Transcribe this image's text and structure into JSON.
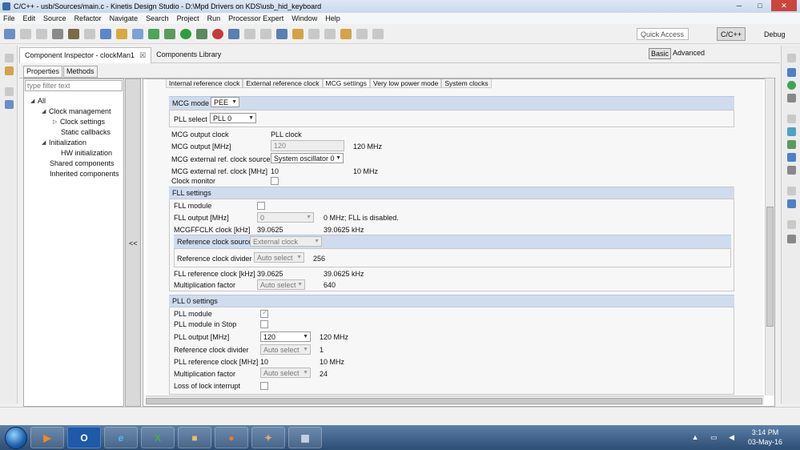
{
  "window": {
    "title": "C/C++ - usb/Sources/main.c - Kinetis Design Studio - D:\\Mpd Drivers on KDS\\usb_hid_keyboard",
    "minimize": "─",
    "maximize": "□",
    "close": "✕"
  },
  "menu": [
    "File",
    "Edit",
    "Source",
    "Refactor",
    "Navigate",
    "Search",
    "Project",
    "Run",
    "Processor Expert",
    "Window",
    "Help"
  ],
  "toolbar": {
    "quick_access_placeholder": "Quick Access",
    "perspective_cpp": "C/C++",
    "perspective_debug": "Debug"
  },
  "views": {
    "component_inspector": "Component Inspector - clockMan1",
    "component_inspector_close": "☒",
    "components_library": "Components Library",
    "basic": "Basic",
    "advanced": "Advanced"
  },
  "props_tabs": [
    "Properties",
    "Methods"
  ],
  "tree": {
    "filter_placeholder": "type filter text",
    "items": [
      {
        "label": "All",
        "expander": "◢"
      },
      {
        "label": "Clock management",
        "expander": "◢"
      },
      {
        "label": "Clock settings",
        "expander": "▷"
      },
      {
        "label": "Static callbacks",
        "expander": ""
      },
      {
        "label": "Initialization",
        "expander": "◢"
      },
      {
        "label": "HW initialization",
        "expander": ""
      },
      {
        "label": "Shared components",
        "expander": ""
      },
      {
        "label": "Inherited components",
        "expander": ""
      }
    ]
  },
  "splitter": {
    "collapse": "<<"
  },
  "mcg_tabs": [
    "Internal reference clock",
    "External reference clock",
    "MCG settings",
    "Very low power mode",
    "System clocks"
  ],
  "mcg": {
    "mode_label": "MCG mode",
    "mode_value": "PEE",
    "pll_select_label": "PLL select",
    "pll_select_value": "PLL 0",
    "output_clock_label": "MCG output clock",
    "output_clock_value": "PLL clock",
    "output_mhz_label": "MCG output [MHz]",
    "output_mhz_value": "120",
    "output_mhz_info": "120 MHz",
    "ext_src_label": "MCG external ref. clock source",
    "ext_src_value": "System oscillator 0",
    "ext_mhz_label": "MCG external ref. clock [MHz]",
    "ext_mhz_value": "10",
    "ext_mhz_info": "10 MHz",
    "clock_monitor_label": "Clock monitor"
  },
  "fll": {
    "header": "FLL settings",
    "module_label": "FLL module",
    "output_label": "FLL output [MHz]",
    "output_value": "0",
    "output_info": "0 MHz; FLL is disabled.",
    "mcgffclk_label": "MCGFFCLK clock [kHz]",
    "mcgffclk_value": "39.0625",
    "mcgffclk_info": "39.0625 kHz",
    "ref_src_label": "Reference clock source",
    "ref_src_value": "External clock",
    "ref_div_label": "Reference clock divider",
    "ref_div_value": "Auto select",
    "ref_div_info": "256",
    "ref_clk_label": "FLL reference clock [kHz]",
    "ref_clk_value": "39.0625",
    "ref_clk_info": "39.0625 kHz",
    "mult_label": "Multiplication factor",
    "mult_value": "Auto select",
    "mult_info": "640"
  },
  "pll0": {
    "header": "PLL 0 settings",
    "module_label": "PLL module",
    "stop_label": "PLL module in Stop",
    "output_label": "PLL output [MHz]",
    "output_value": "120",
    "output_info": "120 MHz",
    "ref_div_label": "Reference clock divider",
    "ref_div_value": "Auto select",
    "ref_div_info": "1",
    "ref_clk_label": "PLL reference clock [MHz]",
    "ref_clk_value": "10",
    "ref_clk_info": "10 MHz",
    "mult_label": "Multiplication factor",
    "mult_value": "Auto select",
    "mult_info": "24",
    "lol_label": "Loss of lock interrupt"
  },
  "taskbar": {
    "apps": [
      "outlook-icon",
      "internet-explorer-icon",
      "excel-icon",
      "explorer-icon",
      "firefox-icon",
      "app-icon",
      "calculator-icon"
    ],
    "outlook_glyph": "O",
    "ie_glyph": "e",
    "excel_glyph": "X",
    "time": "3:14 PM",
    "date": "03-May-16"
  },
  "colors": {
    "group_header": "#cfdcee",
    "taskbar": "#2c4d74",
    "titlebar": "#c9d8ec"
  }
}
